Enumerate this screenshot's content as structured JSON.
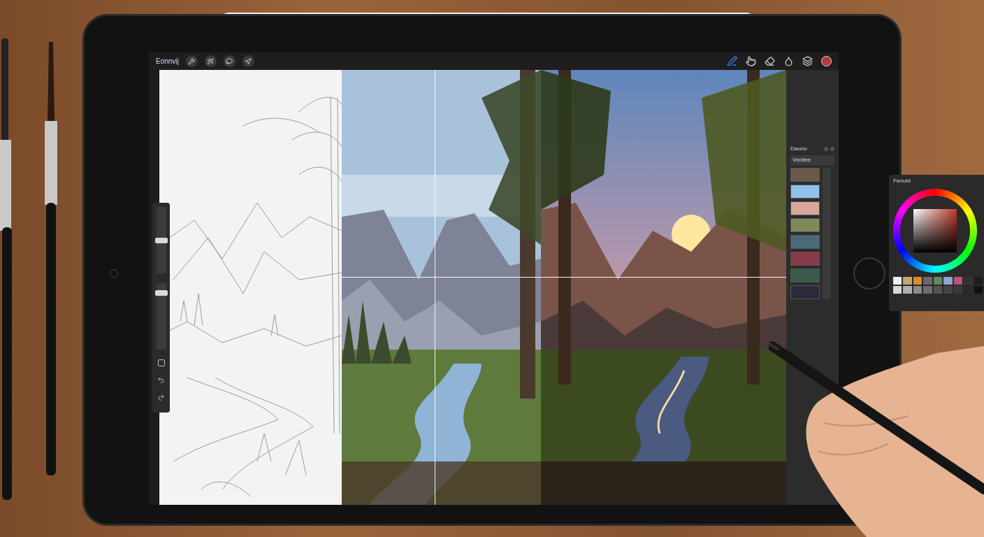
{
  "app": {
    "gallery_label": "Eonnvij"
  },
  "toolbar": {
    "left_tools": [
      {
        "selected": false
      },
      {
        "selected": false
      },
      {
        "selected": false
      },
      {
        "selected": false
      }
    ],
    "right_tools": [
      {
        "selected": true
      },
      {
        "selected": false
      },
      {
        "selected": false
      },
      {
        "selected": false
      },
      {
        "selected": false
      }
    ],
    "current_color": "#b33a3a"
  },
  "sidebar": {
    "sliders": [
      {
        "level": 0.5
      },
      {
        "level": 0.88
      }
    ]
  },
  "canvas": {
    "panels": [
      {
        "kind": "sketch"
      },
      {
        "kind": "flat"
      },
      {
        "kind": "painted"
      }
    ]
  },
  "layers_panel": {
    "title": "Dauno",
    "subtitle": "Vecitee",
    "layers": [
      {
        "color": "#6b5a4a"
      },
      {
        "color": "#8fc3ea"
      },
      {
        "color": "#d8a79b"
      },
      {
        "color": "#7e8a5a"
      },
      {
        "color": "#4a6a7a"
      },
      {
        "color": "#8a3a4a"
      },
      {
        "color": "#3a5a4a"
      },
      {
        "color": "#2a2a3a"
      }
    ]
  },
  "color_panel": {
    "title": "Feoutd",
    "swatches": [
      "#f2f2f2",
      "#c9a46a",
      "#e08a2a",
      "#6a6a6a",
      "#5e8a5e",
      "#8aa6c8",
      "#c0507a",
      "#333333",
      "#1e1e1e",
      "#d9d9d9",
      "#b0b0b0",
      "#8a8a8a",
      "#6e6e6e",
      "#555555",
      "#444444",
      "#3a3a3a",
      "#2a2a2a",
      "#111111"
    ]
  }
}
